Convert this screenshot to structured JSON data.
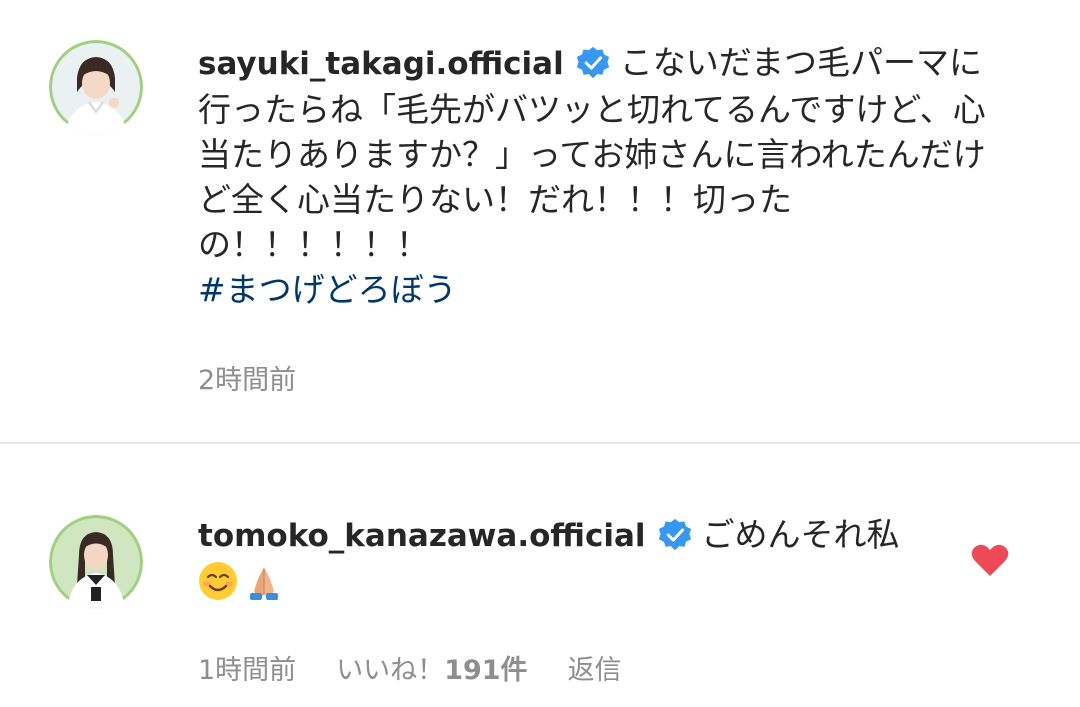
{
  "post": {
    "username": "sayuki_takagi.official",
    "verified": true,
    "caption": "こないだまつ毛パーマに行ったらね「毛先がバツッと切れてるんですけど、心当たりありますか？」ってお姉さんに言われたんだけど全く心当たりない！だれ！！！切ったの！！！！！！",
    "hashtag": "#まつげどろぼう",
    "timestamp": "2時間前",
    "avatar_icon": "profile-photo"
  },
  "reply": {
    "username": "tomoko_kanazawa.official",
    "verified": true,
    "text": "ごめんそれ私",
    "emojis": [
      "smiling-face-emoji",
      "folded-hands-emoji"
    ],
    "timestamp": "1時間前",
    "likes_label": "いいね！",
    "likes_count": "191件",
    "reply_label": "返信",
    "liked": true,
    "avatar_icon": "profile-photo"
  },
  "colors": {
    "verified_blue": "#3897f0",
    "hashtag_blue": "#00376b",
    "like_red": "#ed4956",
    "meta_gray": "#8e8e8e",
    "avatar_bg": "#b7dca0"
  }
}
